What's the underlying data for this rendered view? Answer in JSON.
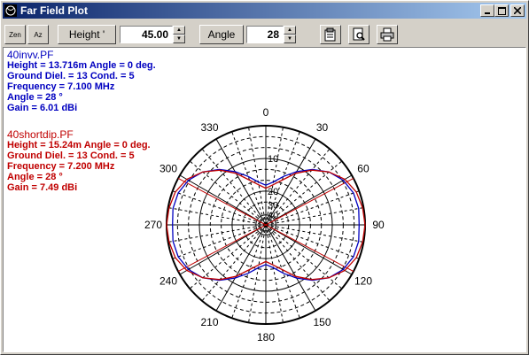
{
  "window": {
    "title": "Far Field Plot"
  },
  "toolbar": {
    "zen_label": "Zen",
    "az_label": "Az",
    "height_label": "Height '",
    "height_value": "45.00",
    "angle_label": "Angle",
    "angle_value": "28"
  },
  "colors": {
    "series1": "#0000c0",
    "series2": "#c00000",
    "grid": "#000000"
  },
  "blocks": [
    {
      "file": "40invv.PF",
      "height_line": "Height =  13.716m Angle =  0 deg.",
      "ground_line": "Ground Diel. =  13  Cond. =  5",
      "freq_line": "Frequency = 7.100 MHz",
      "angle_line": "Angle = 28 °",
      "gain_line": "Gain = 6.01 dBi"
    },
    {
      "file": "40shortdip.PF",
      "height_line": "Height =  15.24m Angle =  0 deg.",
      "ground_line": "Ground Diel. =  13  Cond. =  5",
      "freq_line": "Frequency = 7.200 MHz",
      "angle_line": "Angle = 28 °",
      "gain_line": "Gain = 7.49 dBi"
    }
  ],
  "polar": {
    "angle_labels": [
      "0",
      "30",
      "60",
      "90",
      "120",
      "150",
      "180",
      "210",
      "240",
      "270",
      "300",
      "330"
    ],
    "ring_labels": [
      "10",
      "20",
      "30",
      "40"
    ],
    "angles": [
      0,
      10,
      20,
      30,
      40,
      50,
      60,
      70,
      80,
      90
    ],
    "series": [
      {
        "file": "40invv.PF",
        "color": "#0000c0",
        "values": [
          0.4,
          0.44,
          0.52,
          0.62,
          0.73,
          0.83,
          0.9,
          0.94,
          0.95,
          0.94
        ]
      },
      {
        "file": "40shortdip.PF",
        "color": "#c00000",
        "values": [
          0.37,
          0.41,
          0.48,
          0.6,
          0.72,
          0.83,
          0.92,
          0.97,
          0.99,
          1.0
        ]
      }
    ]
  }
}
